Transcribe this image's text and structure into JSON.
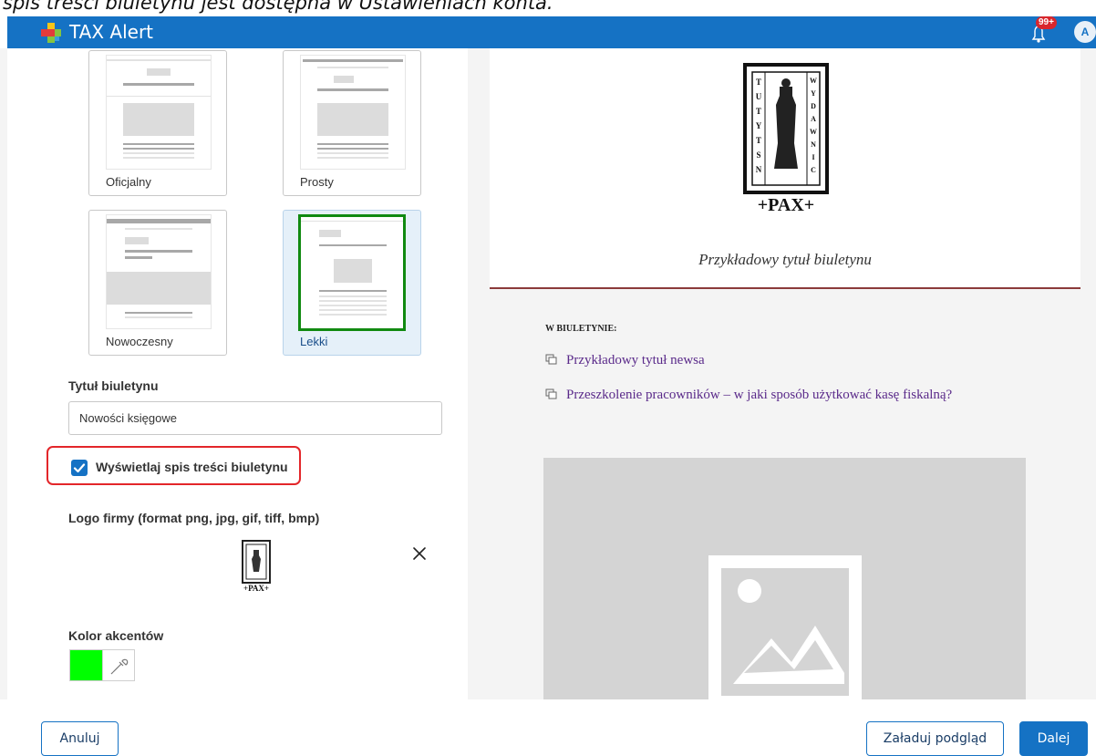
{
  "caption": {
    "text_italic_start": "spis treści biuletynu",
    "text_middle": " jest dostępna w ",
    "text_italic_end": "Ustawieniach konta",
    "text_end": "."
  },
  "app": {
    "title": "TAX Alert",
    "notification_count": "99+",
    "avatar_initials": "A"
  },
  "templates": [
    {
      "label": "Oficjalny",
      "selected": false
    },
    {
      "label": "Prosty",
      "selected": false
    },
    {
      "label": "Nowoczesny",
      "selected": false
    },
    {
      "label": "Lekki",
      "selected": true
    }
  ],
  "form": {
    "title_label": "Tytuł biuletynu",
    "title_value": "Nowości księgowe",
    "toc_checkbox_label": "Wyświetlaj spis treści biuletynu",
    "toc_checkbox_checked": true,
    "logo_label": "Logo firmy (format png, jpg, gif, tiff, bmp)",
    "accent_label": "Kolor akcentów",
    "accent_color": "#00ff00"
  },
  "preview": {
    "logo_text": "+PAX+",
    "newsletter_title": "Przykładowy tytuł biuletynu",
    "toc_heading": "W BIULETYNIE:",
    "toc_items": [
      "Przykładowy tytuł newsa",
      "Przeszkolenie pracowników – w jaki sposób użytkować kasę fiskalną?"
    ],
    "accent_line_color": "#8b3a3a"
  },
  "footer": {
    "cancel_label": "Anuluj",
    "preview_label": "Załaduj podgląd",
    "next_label": "Dalej"
  },
  "colors": {
    "primary": "#1572c4",
    "highlight": "#e3262a",
    "selected_frame": "#118a11"
  }
}
